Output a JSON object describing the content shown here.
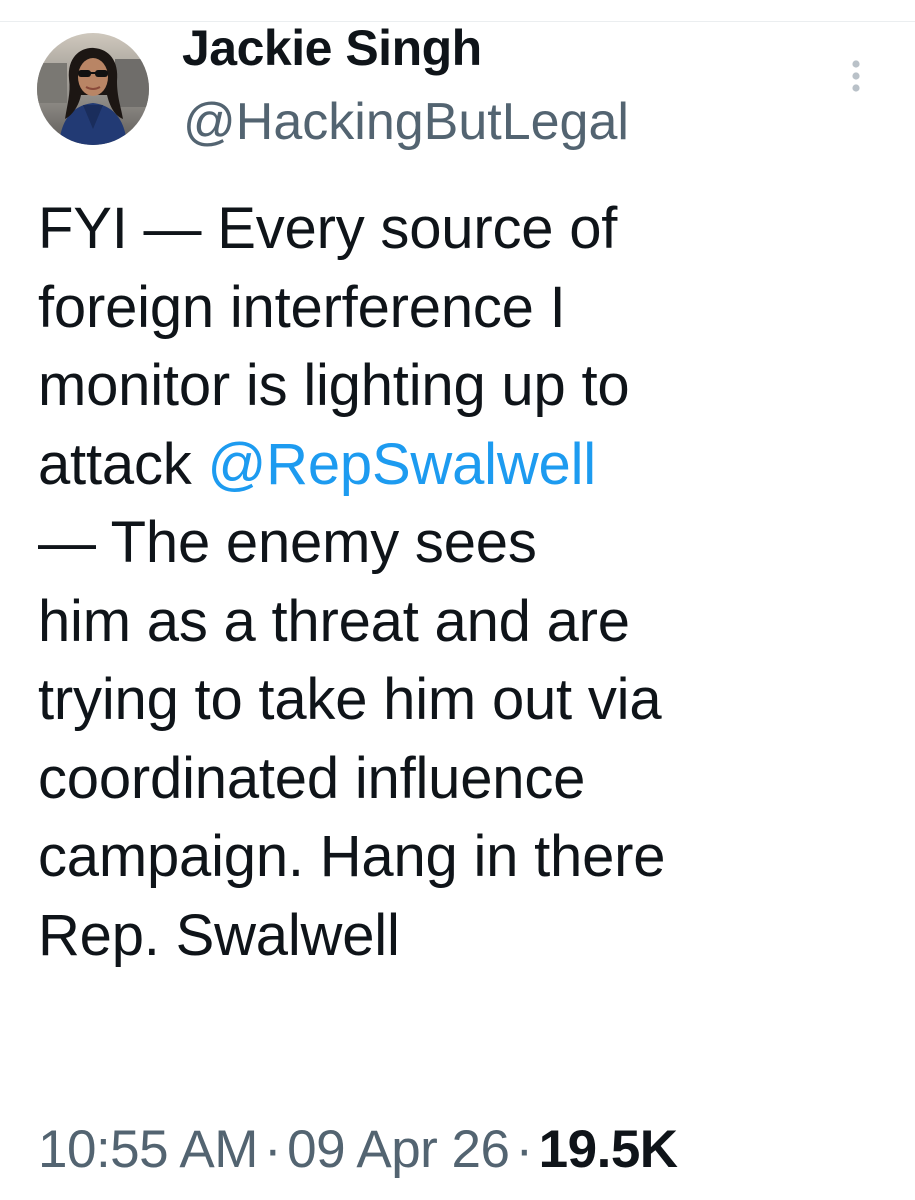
{
  "author": {
    "display_name": "Jackie Singh",
    "handle": "@HackingButLegal"
  },
  "tweet": {
    "line_1": "FYI — Every source of",
    "line_2": "foreign interference I",
    "line_3": "monitor is lighting up to",
    "line_4_prefix": "attack ",
    "mention": "@RepSwalwell",
    "line_5": "— The enemy sees",
    "line_6": "him as a threat and are",
    "line_7": "trying to take him out via",
    "line_8": "coordinated influence",
    "line_9": "campaign. Hang in there",
    "line_10": "Rep. Swalwell"
  },
  "meta": {
    "time": "10:55 AM",
    "separator": "·",
    "date": "09 Apr 26",
    "views": "19.5K"
  },
  "colors": {
    "text": "#0f1419",
    "secondary": "#536471",
    "link": "#1d9bf0"
  },
  "icons": {
    "more": "more-vertical-icon"
  }
}
